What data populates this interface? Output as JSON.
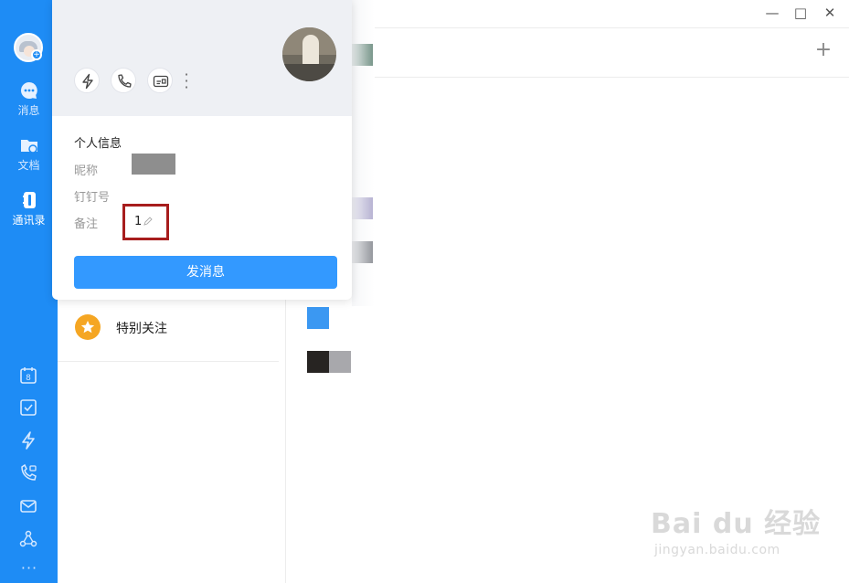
{
  "nav": {
    "items": [
      {
        "label": "消息",
        "icon": "chat-bubble-icon"
      },
      {
        "label": "文档",
        "icon": "folder-icon"
      },
      {
        "label": "通讯录",
        "icon": "contacts-icon"
      }
    ],
    "bottom_icons": [
      "calendar-icon",
      "todo-check-icon",
      "lightning-icon",
      "video-call-icon",
      "mail-icon",
      "workspace-icon"
    ],
    "more": "···",
    "calendar_day": "8"
  },
  "window": {
    "minimize": "—",
    "maximize": "□",
    "close": "✕",
    "add": "+"
  },
  "contacts": {
    "starred_label": "特别关注"
  },
  "profile_card": {
    "section_title": "个人信息",
    "fields": {
      "nickname_label": "昵称",
      "dingtalk_id_label": "钉钉号",
      "remark_label": "备注",
      "remark_value": "1"
    },
    "actions": [
      "lightning-icon",
      "phone-icon",
      "card-icon",
      "more-icon"
    ],
    "send_button": "发消息"
  },
  "watermark": {
    "main": "Bai du 经验",
    "sub": "jingyan.baidu.com"
  },
  "colors": {
    "nav_bg": "#1e8cf5",
    "button_bg": "#3399ff",
    "highlight": "#a71d1d",
    "starred": "#f5a623"
  }
}
